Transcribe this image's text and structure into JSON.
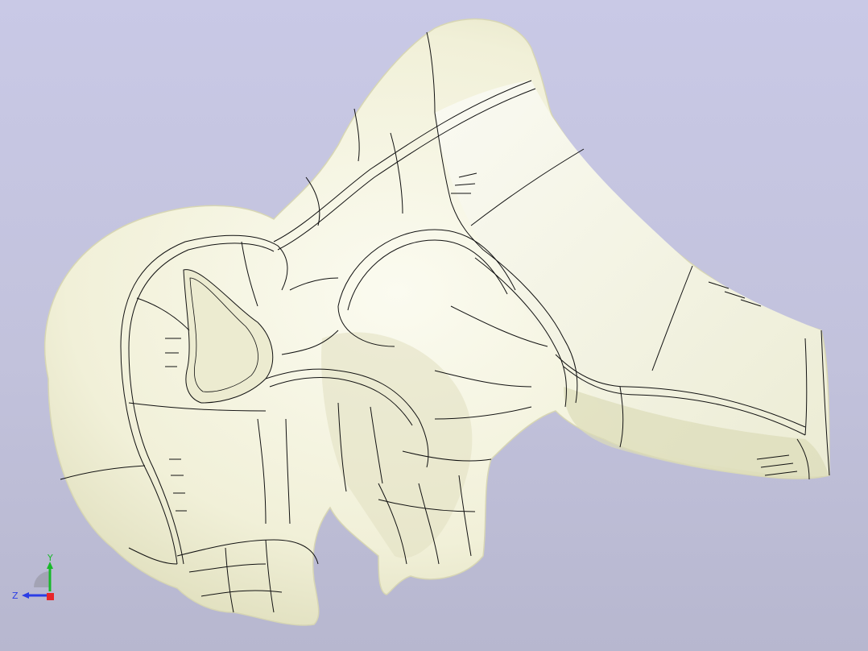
{
  "viewport": {
    "background_top": "#c9c9e6",
    "background_bottom": "#b7b7cf",
    "model_fill": "#f4f3e2",
    "model_shade": "#d9d8b6",
    "edge_color": "#111111"
  },
  "triad": {
    "x_axis_color": "#e8262b",
    "y_axis_color": "#18b82a",
    "z_axis_color": "#2b3de6",
    "y_label": "Y",
    "z_label": "Z"
  }
}
